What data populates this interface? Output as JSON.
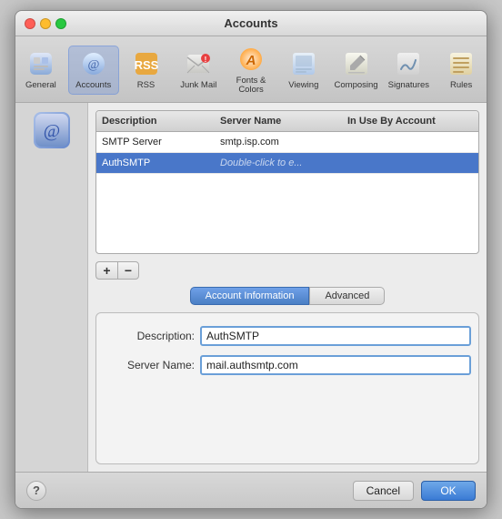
{
  "window": {
    "title": "Accounts"
  },
  "toolbar": {
    "items": [
      {
        "id": "general",
        "label": "General",
        "icon": "general"
      },
      {
        "id": "accounts",
        "label": "Accounts",
        "icon": "accounts",
        "active": true
      },
      {
        "id": "rss",
        "label": "RSS",
        "icon": "rss"
      },
      {
        "id": "junk-mail",
        "label": "Junk Mail",
        "icon": "junk-mail"
      },
      {
        "id": "fonts-colors",
        "label": "Fonts & Colors",
        "icon": "fonts-colors"
      },
      {
        "id": "viewing",
        "label": "Viewing",
        "icon": "viewing"
      },
      {
        "id": "composing",
        "label": "Composing",
        "icon": "composing"
      },
      {
        "id": "signatures",
        "label": "Signatures",
        "icon": "signatures"
      },
      {
        "id": "rules",
        "label": "Rules",
        "icon": "rules"
      }
    ]
  },
  "table": {
    "headers": [
      "Description",
      "Server Name",
      "In Use By Account"
    ],
    "rows": [
      {
        "description": "SMTP Server",
        "server_name": "smtp.isp.com",
        "in_use": "",
        "selected": false
      },
      {
        "description": "AuthSMTP",
        "server_name": "Double-click to e...",
        "in_use": "",
        "selected": true,
        "disabled": true
      }
    ]
  },
  "actions": {
    "add_label": "+",
    "remove_label": "−"
  },
  "tabs": [
    {
      "id": "account-info",
      "label": "Account Information",
      "active": true
    },
    {
      "id": "advanced",
      "label": "Advanced",
      "active": false
    }
  ],
  "form": {
    "description_label": "Description:",
    "description_value": "AuthSMTP",
    "server_name_label": "Server Name:",
    "server_name_value": "mail.authsmtp.com"
  },
  "buttons": {
    "help_label": "?",
    "cancel_label": "Cancel",
    "ok_label": "OK"
  }
}
